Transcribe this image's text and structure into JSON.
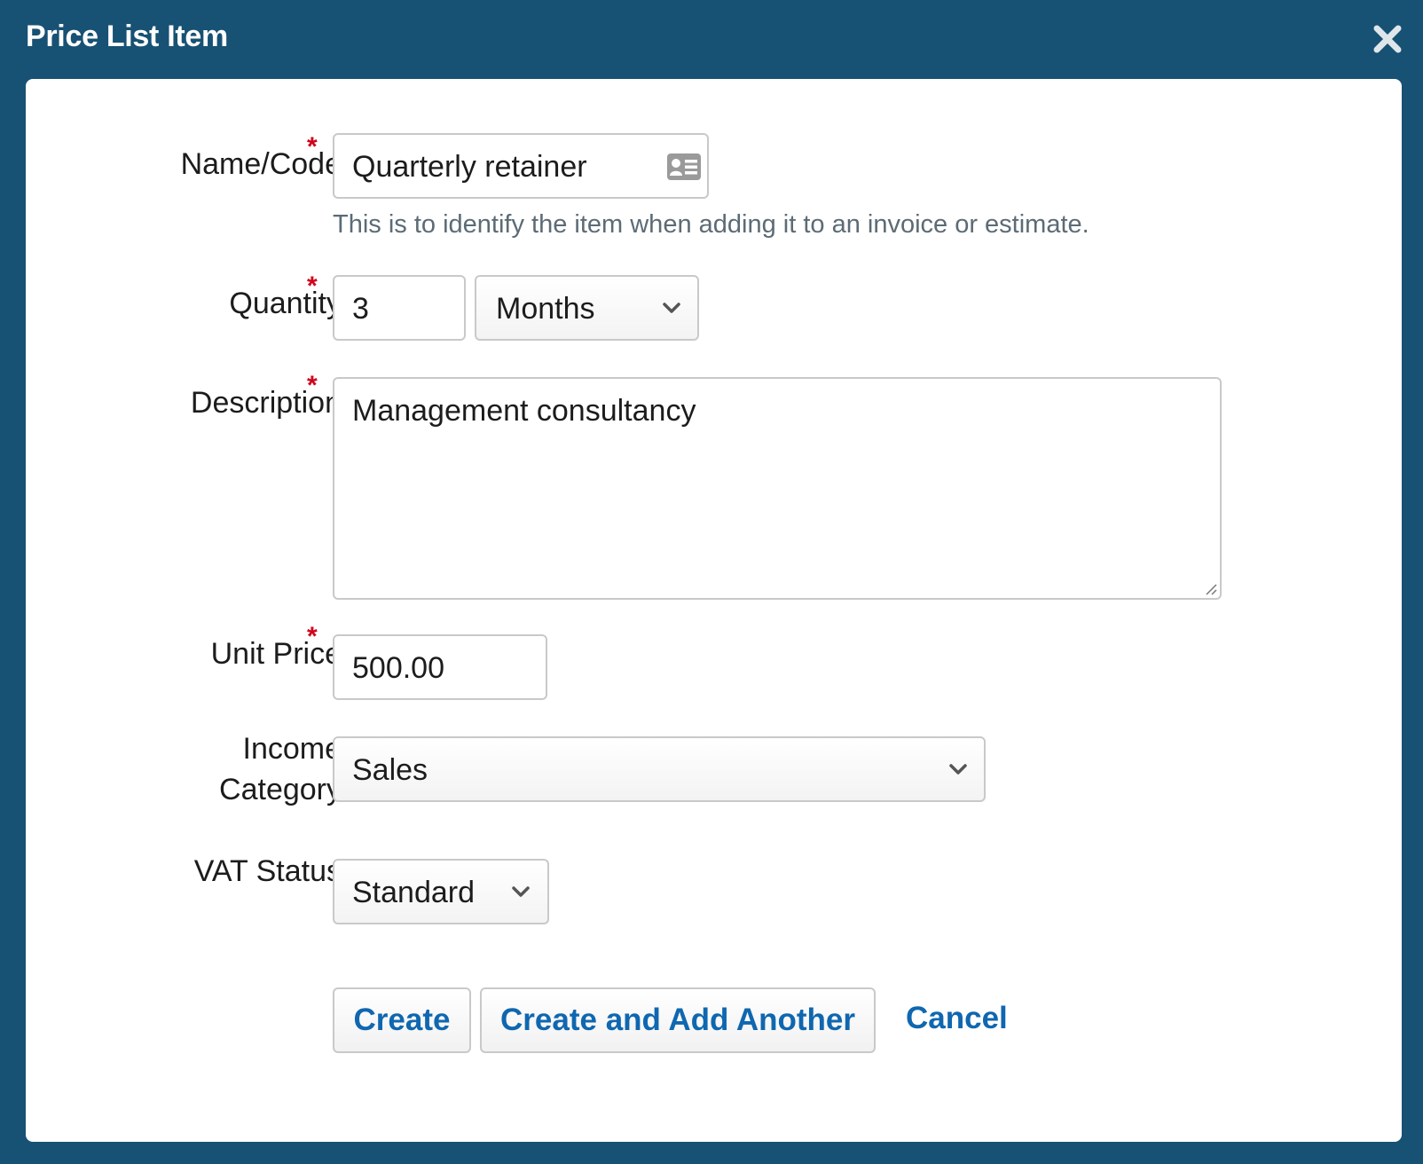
{
  "dialog": {
    "title": "Price List Item"
  },
  "form": {
    "name_code": {
      "label": "Name/Code",
      "value": "Quarterly retainer",
      "hint": "This is to identify the item when adding it to an invoice or estimate.",
      "required_mark": "*"
    },
    "quantity": {
      "label": "Quantity",
      "value": "3",
      "unit": "Months",
      "required_mark": "*"
    },
    "description": {
      "label": "Description",
      "value": "Management consultancy",
      "required_mark": "*"
    },
    "unit_price": {
      "label": "Unit Price",
      "value": "500.00",
      "required_mark": "*"
    },
    "income_category": {
      "label_line1": "Income",
      "label_line2": "Category",
      "value": "Sales"
    },
    "vat_status": {
      "label": "VAT Status",
      "value": "Standard"
    }
  },
  "actions": {
    "create": "Create",
    "create_another": "Create and Add Another",
    "cancel": "Cancel"
  },
  "colors": {
    "header_bg": "#175174",
    "accent": "#0f67b0",
    "required": "#d0021b"
  },
  "icons": {
    "close": "close-icon",
    "contact_card": "contact-card-icon",
    "chevron": "chevron-down-icon"
  }
}
